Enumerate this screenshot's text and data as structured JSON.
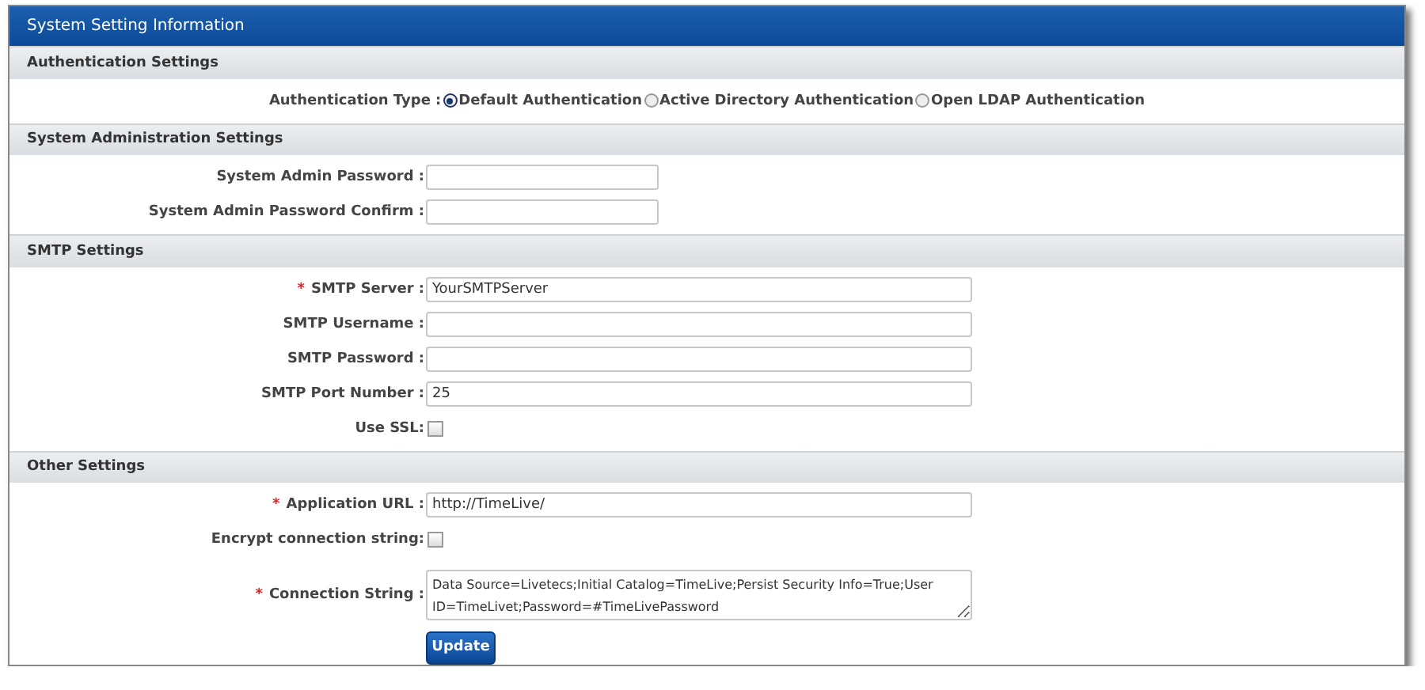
{
  "panel": {
    "title": "System Setting Information"
  },
  "sections": [
    {
      "title": "Authentication Settings",
      "rows": [
        {
          "kind": "radio",
          "label": "Authentication Type :",
          "options": [
            {
              "label": "Default Authentication",
              "selected": true
            },
            {
              "label": "Active Directory Authentication",
              "selected": false
            },
            {
              "label": "Open LDAP Authentication",
              "selected": false
            }
          ]
        }
      ]
    },
    {
      "title": "System Administration Settings",
      "rows": [
        {
          "kind": "short",
          "label": "System Admin Password :"
        },
        {
          "kind": "short",
          "label": "System Admin Password Confirm :"
        }
      ]
    },
    {
      "title": "SMTP Settings",
      "rows": [
        {
          "kind": "text",
          "label": "SMTP Server :",
          "required_mark": "*",
          "value": "YourSMTPServer"
        },
        {
          "kind": "text",
          "label": "SMTP Username :"
        },
        {
          "kind": "text",
          "label": "SMTP Password :"
        },
        {
          "kind": "text",
          "label": "SMTP Port Number :",
          "value": "25"
        },
        {
          "kind": "checkbox",
          "label": "Use SSL:",
          "checked": false
        }
      ]
    },
    {
      "title": "Other Settings",
      "rows": [
        {
          "kind": "text",
          "label": "Application URL :",
          "required_mark": "*",
          "value": "http://TimeLive/"
        },
        {
          "kind": "checkbox",
          "label": "Encrypt connection string:",
          "checked": false
        },
        {
          "kind": "textarea",
          "label": "Connection String :",
          "required_mark": "*",
          "value": "Data Source=Livetecs;Initial Catalog=TimeLive;Persist Security Info=True;User ID=TimeLivet;Password=#TimeLivePassword"
        }
      ]
    }
  ],
  "buttons": [
    {
      "label": "Update"
    }
  ]
}
